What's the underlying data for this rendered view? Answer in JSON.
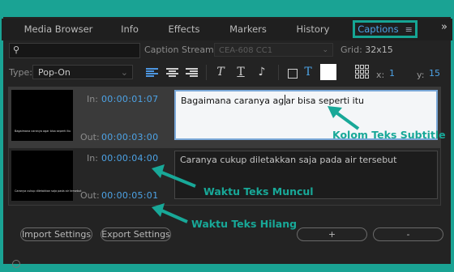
{
  "tabs": [
    {
      "label": "Media Browser"
    },
    {
      "label": "Info"
    },
    {
      "label": "Effects"
    },
    {
      "label": "Markers"
    },
    {
      "label": "History"
    },
    {
      "label": "Captions",
      "active": true
    }
  ],
  "more_glyph": "»",
  "menu_glyph": "≡",
  "toolbar": {
    "search_placeholder": "",
    "caption_stream_label": "Caption Stream:",
    "caption_stream_value": "CEA-608 CC1",
    "grid_label": "Grid:",
    "grid_value": "32x15",
    "type_label": "Type:",
    "type_value": "Pop-On",
    "italic_glyph": "T",
    "underline_glyph": "T",
    "music_glyph": "♪",
    "color_glyph": "T",
    "x_label": "x:",
    "x_value": "1",
    "y_label": "y:",
    "y_value": "15",
    "accent_color": "#4da3e6",
    "swatch_color": "#ffffff"
  },
  "captions": [
    {
      "in_label": "In:",
      "in_time": "00:00:01:07",
      "out_label": "Out:",
      "out_time": "00:00:03:00",
      "text_before_cursor": "Bagaimana caranya ag",
      "text_after_cursor": "ar bisa seperti itu",
      "thumb_text": "Bagaimana caranya agar bisa seperti itu"
    },
    {
      "in_label": "In:",
      "in_time": "00:00:04:00",
      "out_label": "Out:",
      "out_time": "00:00:05:01",
      "text": "Caranya cukup diletakkan saja pada air tersebut",
      "thumb_text": "Caranya cukup diletakkan saja pada air tersebut"
    }
  ],
  "annotations": {
    "subtitle_box": "Kolom Teks Subtitle",
    "time_in": "Waktu Teks Muncul",
    "time_out": "Waktu Teks Hilang",
    "color": "#18a898"
  },
  "bottom": {
    "import_label": "Import Settings",
    "export_label": "Export Settings",
    "add_label": "+",
    "remove_label": "-"
  }
}
